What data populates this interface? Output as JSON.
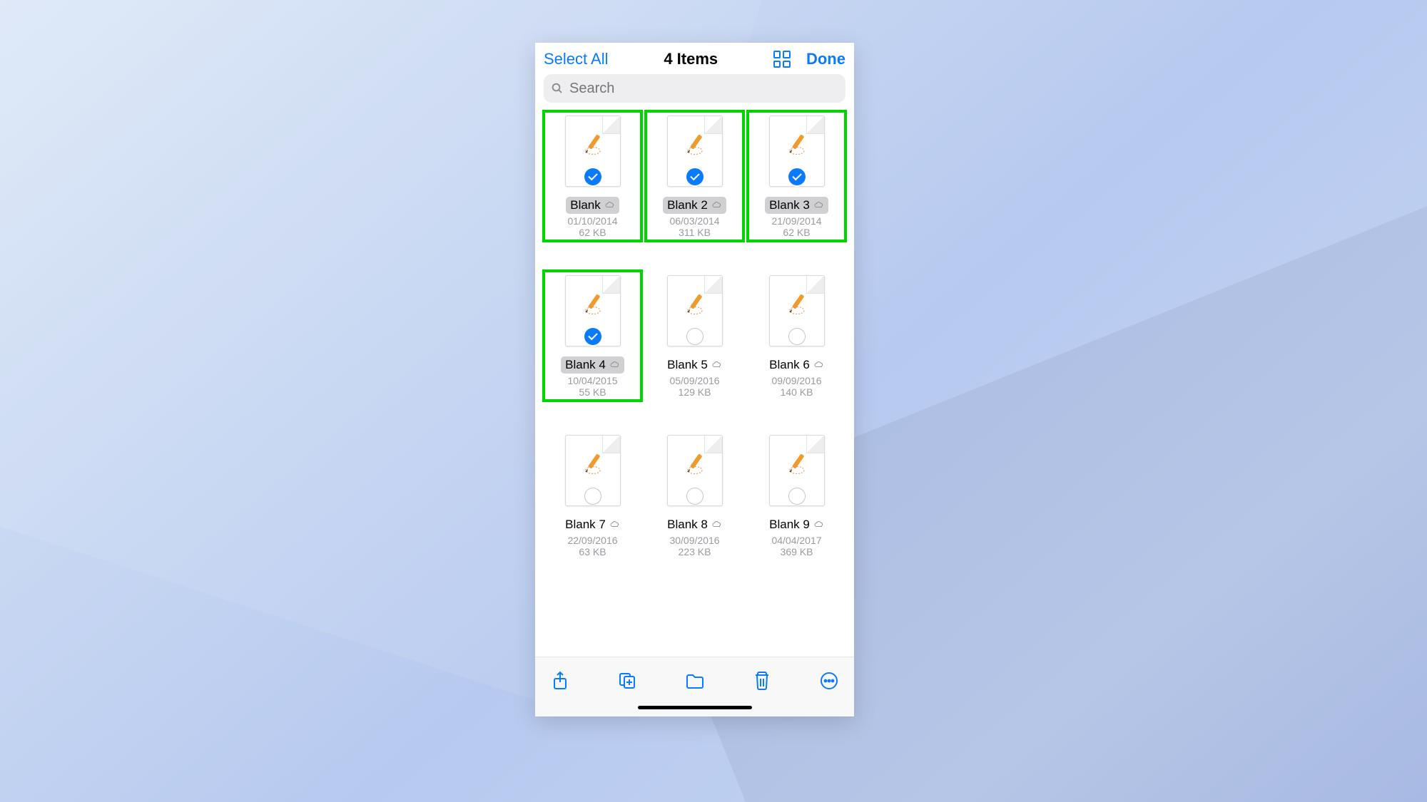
{
  "navbar": {
    "select_all": "Select All",
    "title": "4 Items",
    "done": "Done"
  },
  "search": {
    "placeholder": "Search"
  },
  "files": [
    {
      "name": "Blank",
      "date": "01/10/2014",
      "size": "62 KB",
      "selected": true,
      "highlight": true
    },
    {
      "name": "Blank 2",
      "date": "06/03/2014",
      "size": "311 KB",
      "selected": true,
      "highlight": true
    },
    {
      "name": "Blank 3",
      "date": "21/09/2014",
      "size": "62 KB",
      "selected": true,
      "highlight": true
    },
    {
      "name": "Blank 4",
      "date": "10/04/2015",
      "size": "55 KB",
      "selected": true,
      "highlight": true
    },
    {
      "name": "Blank 5",
      "date": "05/09/2016",
      "size": "129 KB",
      "selected": false,
      "highlight": false
    },
    {
      "name": "Blank 6",
      "date": "09/09/2016",
      "size": "140 KB",
      "selected": false,
      "highlight": false
    },
    {
      "name": "Blank 7",
      "date": "22/09/2016",
      "size": "63 KB",
      "selected": false,
      "highlight": false
    },
    {
      "name": "Blank 8",
      "date": "30/09/2016",
      "size": "223 KB",
      "selected": false,
      "highlight": false
    },
    {
      "name": "Blank 9",
      "date": "04/04/2017",
      "size": "369 KB",
      "selected": false,
      "highlight": false
    }
  ]
}
